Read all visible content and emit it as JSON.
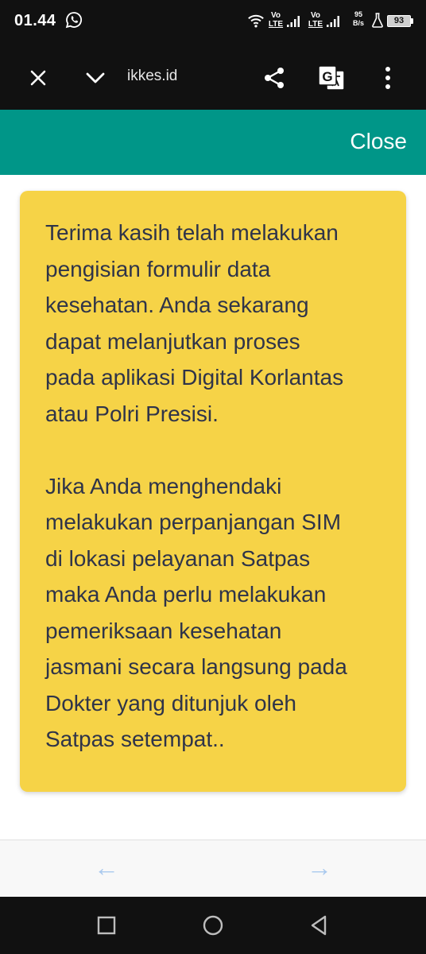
{
  "status_bar": {
    "time": "01.44",
    "network_1": "Vo LTE",
    "network_1_top": "Vo",
    "network_1_bottom": "LTE",
    "network_2_top": "Vo",
    "network_2_bottom": "LTE",
    "speed_value": "95",
    "speed_unit": "B/s",
    "battery": "93"
  },
  "browser": {
    "url": "ikkes.id",
    "icons": [
      "close-icon",
      "chevron-down-icon",
      "share-icon",
      "translate-icon",
      "more-vert-icon"
    ]
  },
  "header": {
    "close_label": "Close",
    "color": "#009688"
  },
  "message": {
    "paragraph_1": [
      "Terima kasih telah melakukan",
      "pengisian formulir data",
      "kesehatan. Anda sekarang",
      "dapat melanjutkan proses",
      "pada aplikasi Digital Korlantas",
      "atau Polri Presisi."
    ],
    "paragraph_2": [
      "Jika Anda menghendaki",
      "melakukan perpanjangan SIM",
      "di lokasi pelayanan Satpas",
      "maka Anda perlu melakukan",
      "pemeriksaan kesehatan",
      "jasmani secara langsung pada",
      "Dokter yang ditunjuk oleh",
      "Satpas setempat.."
    ],
    "card_color": "#f6d347",
    "text_color": "#2f3449"
  },
  "bottom_nav": {
    "back_arrow": "←",
    "forward_arrow": "→"
  },
  "system_nav": {
    "icons": [
      "recents-square-icon",
      "home-circle-icon",
      "back-triangle-icon"
    ]
  }
}
